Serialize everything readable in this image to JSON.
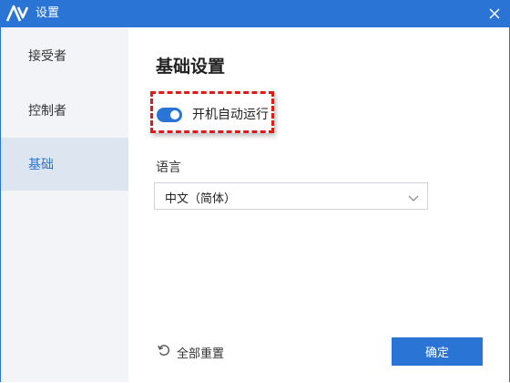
{
  "window": {
    "title": "设置",
    "accent_color": "#2a74d6",
    "close_icon": "close-icon",
    "logo_icon": "app-logo-icon"
  },
  "sidebar": {
    "items": [
      {
        "label": "接受者",
        "active": false
      },
      {
        "label": "控制者",
        "active": false
      },
      {
        "label": "基础",
        "active": true
      }
    ]
  },
  "main": {
    "title": "基础设置",
    "autostart": {
      "label": "开机自动运行",
      "enabled": true
    },
    "highlight_color": "#e21919",
    "language": {
      "label": "语言",
      "selected": "中文（简体）"
    },
    "footer": {
      "reset_label": "全部重置",
      "reset_icon": "reset-icon",
      "ok_label": "确定"
    }
  }
}
